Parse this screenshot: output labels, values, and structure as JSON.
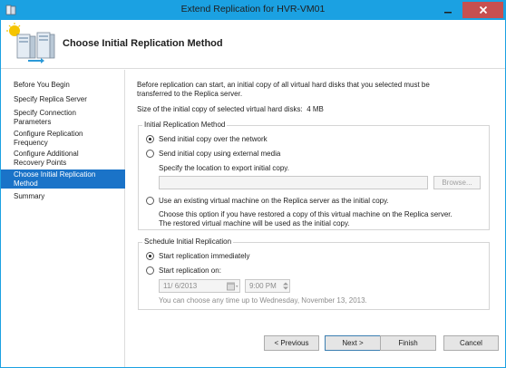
{
  "window": {
    "title": "Extend Replication for HVR-VM01"
  },
  "header": {
    "title": "Choose Initial Replication Method"
  },
  "nav": {
    "items": [
      {
        "label": "Before You Begin"
      },
      {
        "label": "Specify Replica Server"
      },
      {
        "label": "Specify Connection\nParameters"
      },
      {
        "label": "Configure Replication\nFrequency"
      },
      {
        "label": "Configure Additional\nRecovery Points"
      },
      {
        "label": "Choose Initial Replication\nMethod",
        "active": true
      },
      {
        "label": "Summary"
      }
    ]
  },
  "content": {
    "intro_line1": "Before replication can start, an initial copy of all virtual hard disks that you selected must be",
    "intro_line2": "transferred to the Replica server.",
    "size_label": "Size of the initial copy of selected virtual hard disks:",
    "size_value": "4 MB",
    "method_group": {
      "label": "Initial Replication Method",
      "option_network": "Send initial copy over the network",
      "option_external": "Send initial copy using external media",
      "export_location_label": "Specify the location to export initial copy.",
      "export_path_value": "",
      "browse_label": "Browse...",
      "option_existing_vm": "Use an existing virtual machine on the Replica server as the initial copy.",
      "existing_note_line1": "Choose this option if you have restored a copy of this virtual machine on the Replica server.",
      "existing_note_line2": "The restored virtual machine will be used as the initial copy.",
      "selected": "network"
    },
    "schedule_group": {
      "label": "Schedule Initial Replication",
      "option_immediately": "Start replication immediately",
      "option_on": "Start replication on:",
      "date_value": "11/  6/2013",
      "time_value": "9:00 PM",
      "hint": "You can choose any time up to Wednesday, November 13, 2013.",
      "selected": "immediately"
    }
  },
  "footer": {
    "previous_label": "< Previous",
    "next_label": "Next >",
    "finish_label": "Finish",
    "cancel_label": "Cancel"
  },
  "colors": {
    "titlebar": "#1ba1e2",
    "close_button": "#c75050",
    "nav_selected": "#1a73c8"
  },
  "icons": {
    "window": "hyper-v-server-icon",
    "header": "replication-servers-icon",
    "calendar": "calendar-icon",
    "spinner": "spinner-arrows-icon"
  }
}
